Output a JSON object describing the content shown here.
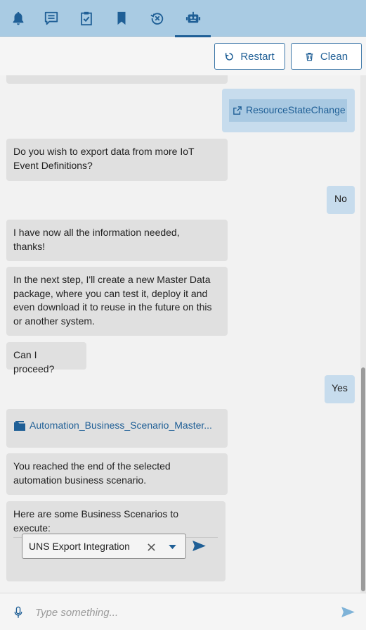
{
  "nav": {
    "tabs": [
      {
        "name": "notifications",
        "icon": "bell-icon"
      },
      {
        "name": "messages",
        "icon": "chat-icon"
      },
      {
        "name": "tasks",
        "icon": "clipboard-check-icon"
      },
      {
        "name": "bookmarks",
        "icon": "bookmark-icon"
      },
      {
        "name": "history",
        "icon": "history-cancel-icon"
      },
      {
        "name": "assistant",
        "icon": "robot-icon",
        "active": true
      }
    ]
  },
  "toolbar": {
    "restart_label": "Restart",
    "clean_label": "Clean"
  },
  "chat": {
    "messages": {
      "resource_link": "ResourceStateChange",
      "q_export_more_l1": "Do you wish to export data from more IoT",
      "q_export_more_l2": "Event Definitions?",
      "reply_no": "No",
      "info_done_l1": "I have now all the information needed,",
      "info_done_l2": "thanks!",
      "next_step_l1": "In the next step, I'll create a new Master Data",
      "next_step_l2": "package, where you can test it, deploy it and",
      "next_step_l3": "even download it to reuse in the future on this",
      "next_step_l4": "or another system.",
      "can_proceed": "Can I proceed?",
      "reply_yes": "Yes",
      "package_link": "Automation_Business_Scenario_Master...",
      "end_l1": "You reached the end of the selected",
      "end_l2": "automation business scenario.",
      "scenarios_label": "Here are some Business Scenarios to execute:",
      "scenario_selected": "UNS Export Integration"
    }
  },
  "input": {
    "placeholder": "Type something..."
  },
  "colors": {
    "topbar": "#a9cbe3",
    "accent": "#1f5f96",
    "bot_bubble": "#e0e0e0",
    "user_bubble": "#c7dced"
  }
}
